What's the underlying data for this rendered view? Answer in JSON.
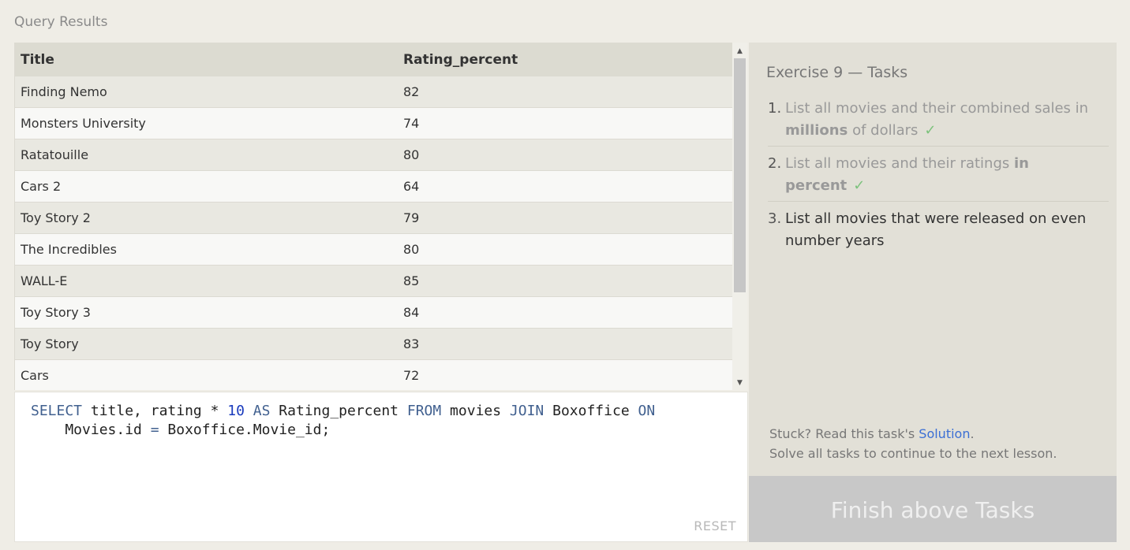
{
  "section_title": "Query Results",
  "results": {
    "columns": [
      "Title",
      "Rating_percent"
    ],
    "rows": [
      [
        "Finding Nemo",
        "82"
      ],
      [
        "Monsters University",
        "74"
      ],
      [
        "Ratatouille",
        "80"
      ],
      [
        "Cars 2",
        "64"
      ],
      [
        "Toy Story 2",
        "79"
      ],
      [
        "The Incredibles",
        "80"
      ],
      [
        "WALL-E",
        "85"
      ],
      [
        "Toy Story 3",
        "84"
      ],
      [
        "Toy Story",
        "83"
      ],
      [
        "Cars",
        "72"
      ]
    ]
  },
  "editor": {
    "line1": {
      "select": "SELECT",
      "title": " title, rating * ",
      "ten": "10",
      "as": " AS",
      "rating_percent": " Rating_percent ",
      "from": "FROM",
      "movies": " movies ",
      "join": "JOIN",
      "boxoffice": " Boxoffice ",
      "on": "ON"
    },
    "line2": {
      "movies_id": "    Movies.id ",
      "eq": "=",
      "rest": " Boxoffice.Movie_id;"
    },
    "reset_label": "RESET"
  },
  "tasks": {
    "heading": "Exercise 9 — Tasks",
    "items": [
      {
        "num": "1.",
        "text_a": "List all movies and their combined sales in ",
        "bold": "millions",
        "text_b": " of dollars",
        "check": "✓"
      },
      {
        "num": "2.",
        "text_a": "List all movies and their ratings ",
        "bold": "in percent",
        "text_b": "",
        "check": "✓"
      },
      {
        "num": "3.",
        "text_a": "List all movies that were released on even number years"
      }
    ],
    "help_prefix": "Stuck? Read this task's ",
    "help_link": "Solution",
    "help_suffix": ".",
    "help_line2": "Solve all tasks to continue to the next lesson.",
    "finish_button": "Finish above Tasks"
  },
  "colors": {
    "keyword": "#41608f",
    "number": "#1a3bbd",
    "check": "#7cc27c",
    "link": "#3b6fd4"
  }
}
